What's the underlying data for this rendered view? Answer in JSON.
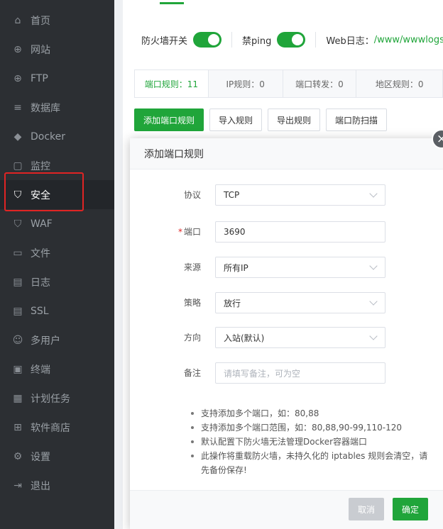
{
  "sidebar": {
    "items": [
      {
        "label": "首页",
        "icon": "home-icon",
        "glyph": "⌂"
      },
      {
        "label": "网站",
        "icon": "globe-icon",
        "glyph": "⊕"
      },
      {
        "label": "FTP",
        "icon": "ftp-globe-icon",
        "glyph": "⊕"
      },
      {
        "label": "数据库",
        "icon": "database-icon",
        "glyph": "≡"
      },
      {
        "label": "Docker",
        "icon": "docker-icon",
        "glyph": "◆"
      },
      {
        "label": "监控",
        "icon": "monitor-icon",
        "glyph": "▢"
      },
      {
        "label": "安全",
        "icon": "shield-icon",
        "glyph": "⛉"
      },
      {
        "label": "WAF",
        "icon": "waf-shield-icon",
        "glyph": "⛉"
      },
      {
        "label": "文件",
        "icon": "folder-icon",
        "glyph": "▭"
      },
      {
        "label": "日志",
        "icon": "log-icon",
        "glyph": "▤"
      },
      {
        "label": "SSL",
        "icon": "ssl-icon",
        "glyph": "▤"
      },
      {
        "label": "多用户",
        "icon": "users-icon",
        "glyph": "☺"
      },
      {
        "label": "终端",
        "icon": "terminal-icon",
        "glyph": "▣"
      },
      {
        "label": "计划任务",
        "icon": "calendar-icon",
        "glyph": "▦"
      },
      {
        "label": "软件商店",
        "icon": "apps-icon",
        "glyph": "⊞"
      },
      {
        "label": "设置",
        "icon": "gear-icon",
        "glyph": "⚙"
      },
      {
        "label": "退出",
        "icon": "logout-icon",
        "glyph": "⇥"
      }
    ],
    "active_index": 6
  },
  "toolbar": {
    "firewall_label": "防火墙开关",
    "ping_label": "禁ping",
    "weblog_label": "Web日志：",
    "weblog_path": "/www/wwwlogs"
  },
  "tabs": [
    {
      "label": "端口规则：11"
    },
    {
      "label": "IP规则：0"
    },
    {
      "label": "端口转发：0"
    },
    {
      "label": "地区规则：0"
    }
  ],
  "actions": {
    "add_port": "添加端口规则",
    "import": "导入规则",
    "export": "导出规则",
    "scan": "端口防扫描"
  },
  "modal": {
    "title": "添加端口规则",
    "close_glyph": "×",
    "fields": {
      "protocol": {
        "label": "协议",
        "value": "TCP"
      },
      "port": {
        "label": "端口",
        "required_mark": "*",
        "value": "3690"
      },
      "source": {
        "label": "来源",
        "value": "所有IP"
      },
      "policy": {
        "label": "策略",
        "value": "放行"
      },
      "direction": {
        "label": "方向",
        "value": "入站(默认)"
      },
      "remark": {
        "label": "备注",
        "placeholder": "请填写备注，可为空"
      }
    },
    "notes": [
      "支持添加多个端口，如：80,88",
      "支持添加多个端口范围，如：80,88,90-99,110-120",
      "默认配置下防火墙无法管理Docker容器端口",
      "此操作将重载防火墙，未持久化的 iptables 规则会清空，请先备份保存!"
    ],
    "cancel": "取消",
    "confirm": "确定"
  },
  "colors": {
    "accent": "#20a53a",
    "sidebar_bg": "#2c2f33",
    "highlight": "#e02424"
  }
}
